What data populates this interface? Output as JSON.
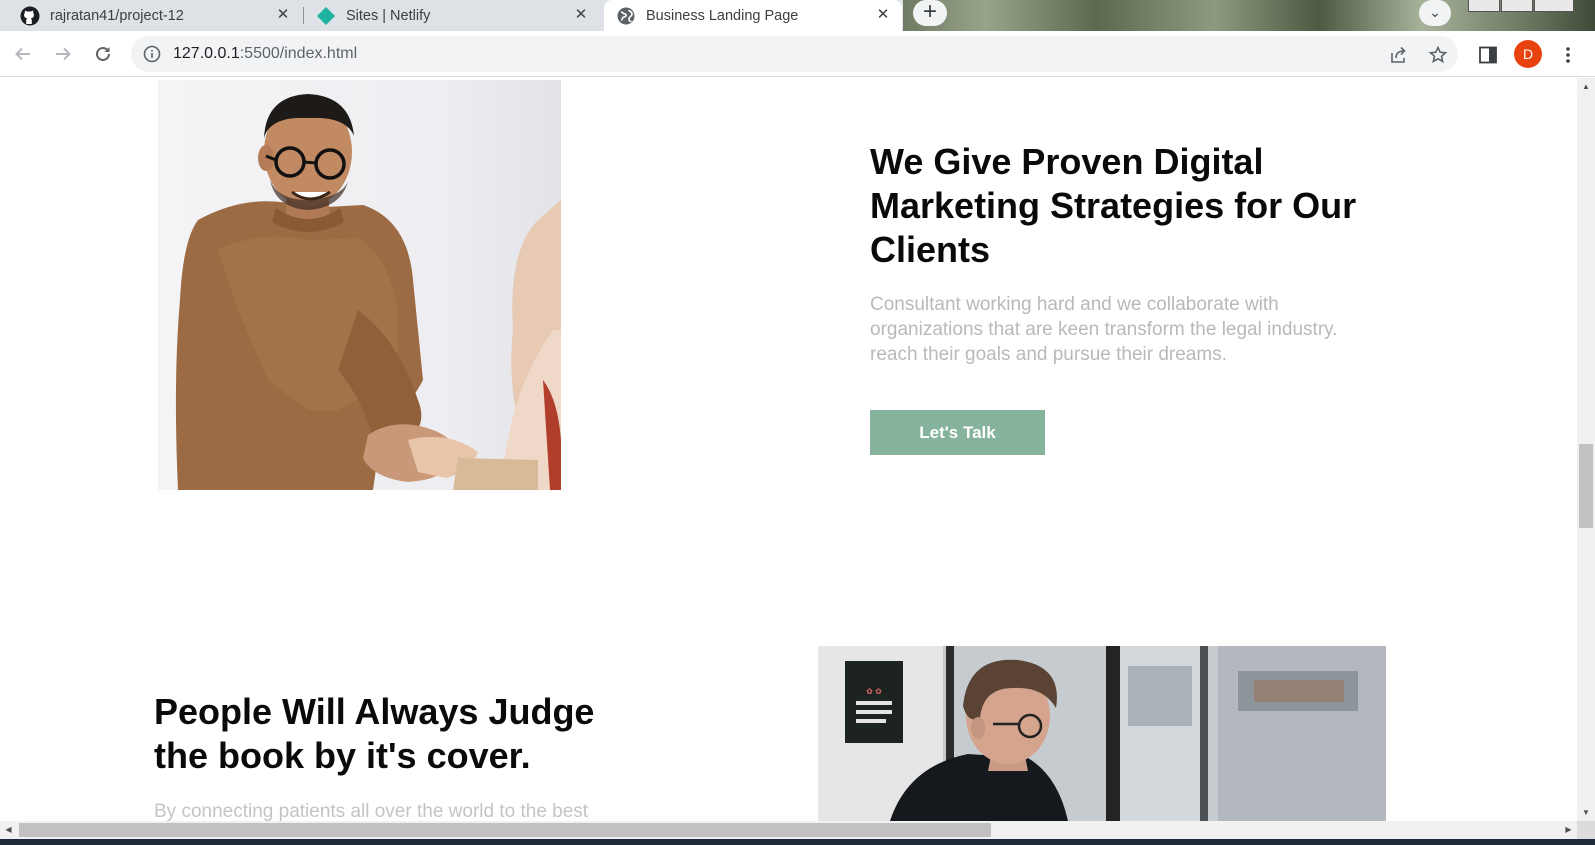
{
  "browser": {
    "tabs": [
      {
        "title": "rajratan41/project-12",
        "icon": "github-icon"
      },
      {
        "title": "Sites | Netlify",
        "icon": "netlify-icon"
      },
      {
        "title": "Business Landing Page",
        "icon": "globe-icon",
        "active": true
      }
    ],
    "close_glyph": "✕",
    "new_tab_glyph": "+",
    "tab_list_glyph": "⌄",
    "address": {
      "host": "127.0.0.1",
      "rest": ":5500/index.html"
    },
    "profile_initial": "D",
    "profile_color": "#e8430e"
  },
  "section_one": {
    "heading": "We Give Proven Digital Marketing Strategies for Our Clients",
    "body": "Consultant working hard and we collaborate with organizations that are keen transform the legal industry. reach their goals and pursue their dreams.",
    "cta_label": "Let's Talk",
    "cta_color": "#86b39c"
  },
  "section_two": {
    "heading": "People Will Always Judge the book by it's cover.",
    "body": "By connecting patients all over the world to the best"
  },
  "scrollbars": {
    "vertical_thumb_fraction": 0.47
  }
}
